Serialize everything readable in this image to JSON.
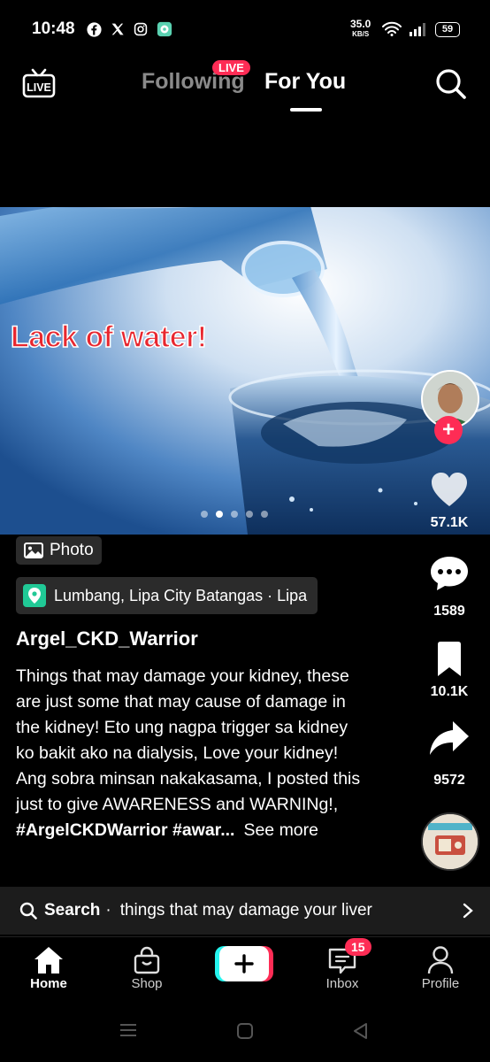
{
  "status": {
    "time": "10:48",
    "net_speed_value": "35.0",
    "net_speed_unit": "KB/S",
    "battery": "59",
    "notification_icons": [
      "facebook-icon",
      "x-icon",
      "instagram-icon",
      "chat-app-icon"
    ]
  },
  "top_nav": {
    "live_label": "LIVE",
    "tab_following": "Following",
    "tab_live_badge": "LIVE",
    "tab_for_you": "For You",
    "active_tab": "For You"
  },
  "post": {
    "overlay_text": "Lack of water!",
    "carousel_dots": 5,
    "carousel_active": 1,
    "type_label": "Photo",
    "location": "Lumbang, Lipa City Batangas · Lipa",
    "username": "Argel_CKD_Warrior",
    "caption": "Things that may damage your kidney, these are just some that may cause of damage in the kidney! Eto ung nagpa trigger sa kidney ko bakit ako na dialysis, Love your kidney! Ang sobra minsan nakakasama, I posted this just to give AWARENESS and WARNINg!,",
    "caption_tags": "#ArgelCKDWarrior #awar...",
    "see_more": "See more"
  },
  "rail": {
    "likes": "57.1K",
    "comments": "1589",
    "bookmarks": "10.1K",
    "shares": "9572"
  },
  "search_bar": {
    "label": "Search",
    "separator": "·",
    "query": "things that may damage your liver"
  },
  "bottom_nav": {
    "home": "Home",
    "shop": "Shop",
    "inbox": "Inbox",
    "inbox_badge": "15",
    "profile": "Profile"
  },
  "colors": {
    "accent": "#fe2c55",
    "location_pin": "#20c996",
    "overlay_text": "#e8272f"
  }
}
